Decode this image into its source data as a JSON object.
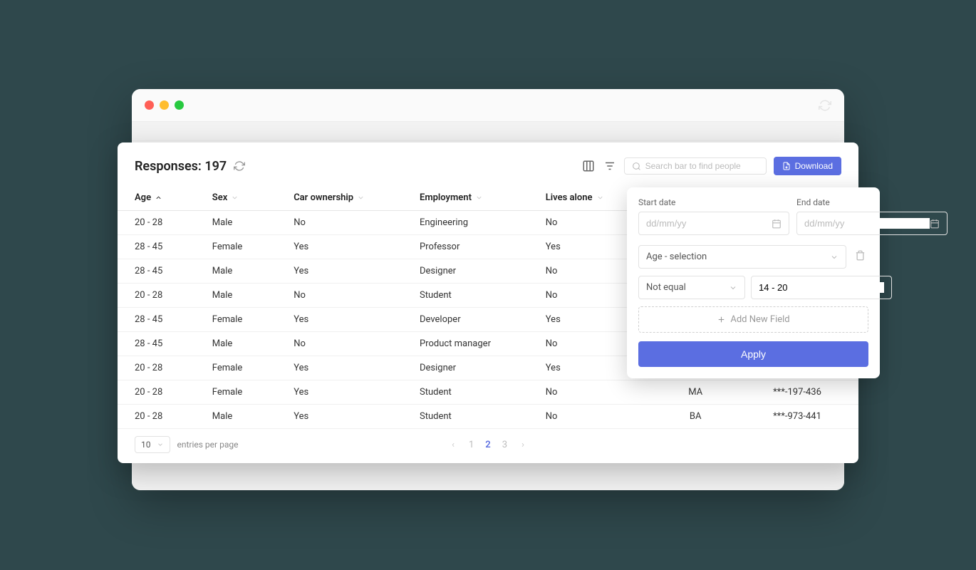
{
  "header": {
    "title": "Responses: 197",
    "search_placeholder": "Search bar to find people",
    "download_label": "Download"
  },
  "columns": [
    {
      "label": "Age",
      "sort": "asc"
    },
    {
      "label": "Sex",
      "sort": null
    },
    {
      "label": "Car ownership",
      "sort": null
    },
    {
      "label": "Employment",
      "sort": null
    },
    {
      "label": "Lives alone",
      "sort": null
    },
    {
      "label": "",
      "sort": null
    },
    {
      "label": "",
      "sort": null
    }
  ],
  "rows": [
    {
      "age": "20 - 28",
      "sex": "Male",
      "car": "No",
      "emp": "Engineering",
      "alone": "No",
      "edu": "",
      "phone": ""
    },
    {
      "age": "28 - 45",
      "sex": "Female",
      "car": "Yes",
      "emp": "Professor",
      "alone": "Yes",
      "edu": "",
      "phone": ""
    },
    {
      "age": "28 - 45",
      "sex": "Male",
      "car": "Yes",
      "emp": "Designer",
      "alone": "No",
      "edu": "",
      "phone": ""
    },
    {
      "age": "20 - 28",
      "sex": "Male",
      "car": "No",
      "emp": "Student",
      "alone": "No",
      "edu": "",
      "phone": ""
    },
    {
      "age": "28 - 45",
      "sex": "Female",
      "car": "Yes",
      "emp": "Developer",
      "alone": "Yes",
      "edu": "",
      "phone": ""
    },
    {
      "age": "28 - 45",
      "sex": "Male",
      "car": "No",
      "emp": "Product manager",
      "alone": "No",
      "edu": "",
      "phone": ""
    },
    {
      "age": "20 - 28",
      "sex": "Female",
      "car": "Yes",
      "emp": "Designer",
      "alone": "Yes",
      "edu": "",
      "phone": ""
    },
    {
      "age": "20 - 28",
      "sex": "Female",
      "car": "Yes",
      "emp": "Student",
      "alone": "No",
      "edu": "MA",
      "phone": "***-197-436"
    },
    {
      "age": "20 - 28",
      "sex": "Male",
      "car": "Yes",
      "emp": "Student",
      "alone": "No",
      "edu": "BA",
      "phone": "***-973-441"
    }
  ],
  "footer": {
    "entries_value": "10",
    "entries_label": "entries per page",
    "pages": [
      "1",
      "2",
      "3"
    ],
    "active_page": "2"
  },
  "filter": {
    "start_label": "Start date",
    "end_label": "End date",
    "date_placeholder": "dd/mm/yy",
    "field_select": "Age - selection",
    "operator": "Not equal",
    "value": "14 - 20",
    "add_label": "Add New Field",
    "apply_label": "Apply"
  }
}
